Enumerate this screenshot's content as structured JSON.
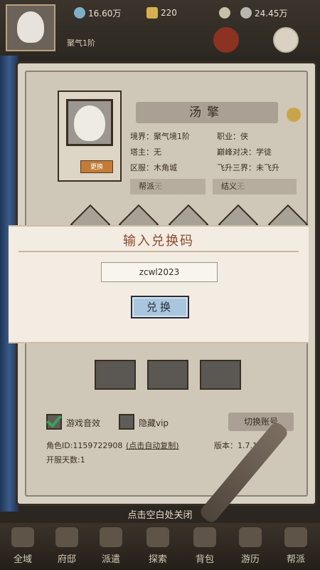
{
  "topbar": {
    "player_level_badge": "",
    "player_name": "",
    "player_realm": "聚气1阶",
    "resources": [
      {
        "icon": "spirit-stone-icon",
        "value": "16.60万"
      },
      {
        "icon": "gold-ingot-icon",
        "value": "220"
      },
      {
        "icon": "power-icon",
        "value": ""
      },
      {
        "icon": "coin-icon",
        "value": "24.45万"
      }
    ]
  },
  "profile": {
    "name": "汤擎",
    "change_label": "更换",
    "realm": "境界：聚气境1阶",
    "job": "职业：侠",
    "tower": "塔主：无",
    "peak": "巅峰对决：学徒",
    "server": "区服：木角城",
    "ascend": "飞升三界：未飞升",
    "sect_label": "帮派",
    "sect_value": "无",
    "sworn_label": "结义",
    "sworn_value": "无",
    "game_sound": "游戏音效",
    "hide_vip": "隐藏vip",
    "switch_account": "切换账号",
    "role_id": "角色ID:1159722908",
    "copy_hint": "(点击自动复制)",
    "version": "版本：1.7.1",
    "open_days": "开服天数:1"
  },
  "modal": {
    "title": "输入兑换码",
    "code_value": "zcwl2023",
    "redeem_label": "兑换"
  },
  "close_tip": "点击空白处关闭",
  "nav": [
    {
      "icon": "world-icon",
      "label": "全域"
    },
    {
      "icon": "mansion-icon",
      "label": "府邸"
    },
    {
      "icon": "sect-icon",
      "label": "派遣"
    },
    {
      "icon": "explore-icon",
      "label": "探索"
    },
    {
      "icon": "bag-icon",
      "label": "背包"
    },
    {
      "icon": "travel-icon",
      "label": "游历"
    },
    {
      "icon": "guild-icon",
      "label": "帮派"
    }
  ]
}
